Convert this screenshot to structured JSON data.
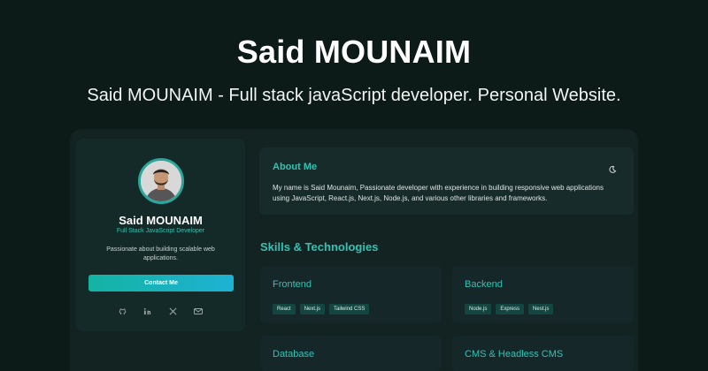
{
  "hero": {
    "title": "Said MOUNAIM",
    "subtitle": "Said MOUNAIM - Full stack javaScript developer. Personal Website."
  },
  "profile": {
    "name": "Said MOUNAIM",
    "role": "Full Stack JavaScript Developer",
    "bio": "Passionate about building scalable web applications.",
    "contact_label": "Contact Me",
    "socials": [
      "github-icon",
      "linkedin-icon",
      "x-icon",
      "mail-icon"
    ]
  },
  "about": {
    "title": "About Me",
    "text": "My name is Said Mounaim, Passionate developer with experience in building responsive web applications using JavaScript, React.js, Next.js, Node.js, and various other libraries and frameworks."
  },
  "skills": {
    "heading": "Skills & Technologies",
    "categories": [
      {
        "title": "Frontend",
        "tags": [
          "React",
          "Next.js",
          "Tailwind CSS"
        ]
      },
      {
        "title": "Backend",
        "tags": [
          "Node.js",
          "Express",
          "Nest.js"
        ]
      },
      {
        "title": "Database",
        "tags": []
      },
      {
        "title": "CMS & Headless CMS",
        "tags": []
      }
    ]
  },
  "colors": {
    "background": "#0c1a18",
    "accent": "#33c2b3",
    "card": "#162b2a"
  }
}
